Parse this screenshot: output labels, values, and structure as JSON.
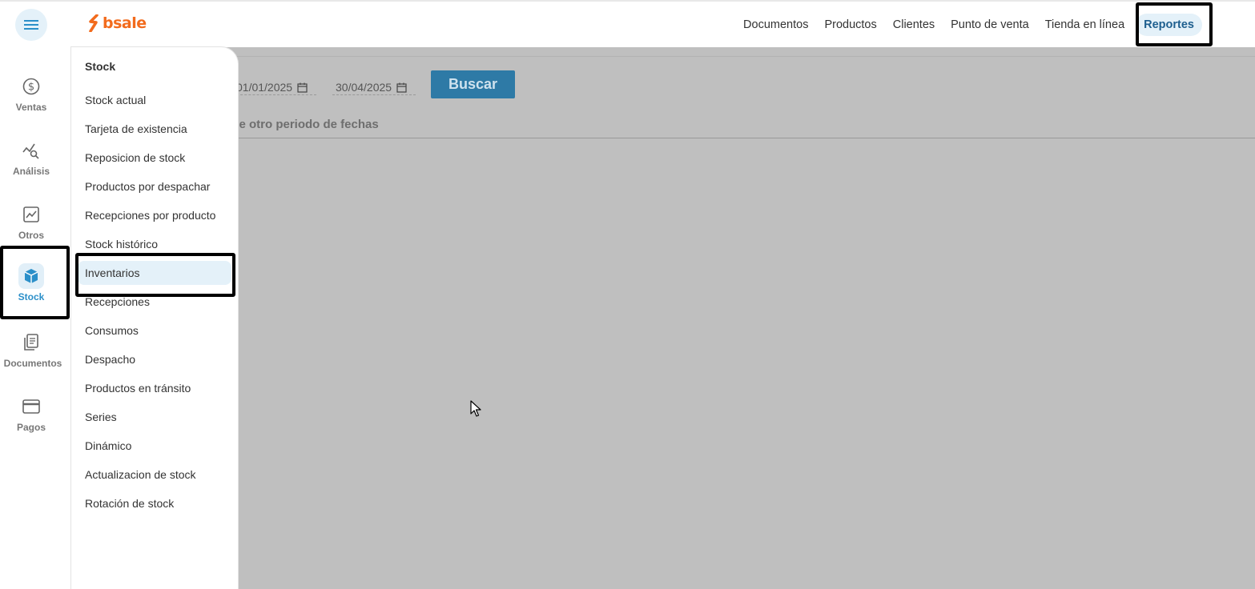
{
  "brand": {
    "name": "bsale",
    "color": "#f26b1d"
  },
  "topnav": {
    "items": [
      "Documentos",
      "Productos",
      "Clientes",
      "Punto de venta",
      "Tienda en línea"
    ],
    "active": "Reportes"
  },
  "sidebar": {
    "items": [
      {
        "label": "Ventas",
        "icon": "dollar-circle-icon"
      },
      {
        "label": "Análisis",
        "icon": "analysis-chart-icon"
      },
      {
        "label": "Otros",
        "icon": "trend-chart-icon"
      },
      {
        "label": "Stock",
        "icon": "box-icon",
        "active": true
      },
      {
        "label": "Documentos",
        "icon": "documents-icon"
      },
      {
        "label": "Pagos",
        "icon": "card-icon"
      }
    ]
  },
  "menu": {
    "title": "Stock",
    "items": [
      "Stock actual",
      "Tarjeta de existencia",
      "Reposicion de stock",
      "Productos por despachar",
      "Recepciones por producto",
      "Stock histórico",
      "Inventarios",
      "Recepciones",
      "Consumos",
      "Despacho",
      "Productos en tránsito",
      "Series",
      "Dinámico",
      "Actualizacion de stock",
      "Rotación de stock"
    ],
    "highlighted": "Inventarios"
  },
  "filters": {
    "date_from": "01/01/2025",
    "date_to": "30/04/2025",
    "search_label": "Buscar"
  },
  "message": "ebe otro periodo de fechas",
  "colors": {
    "accent": "#2b8fc9",
    "button": "#2e7aa6",
    "overlay": "#bfbfbf"
  }
}
